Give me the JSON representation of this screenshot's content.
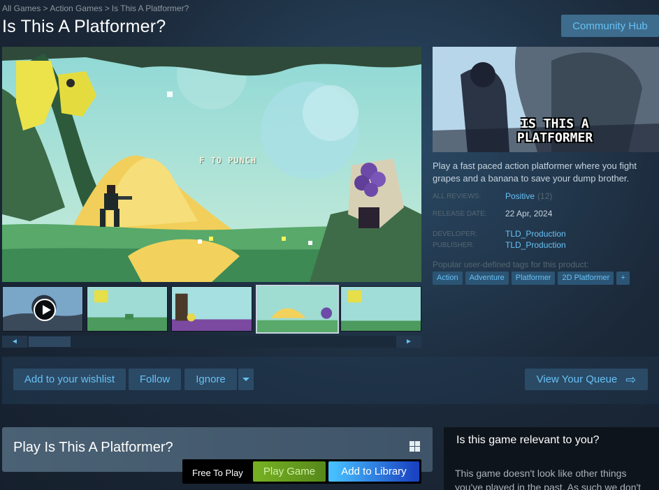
{
  "breadcrumb": {
    "items": [
      "All Games",
      "Action Games",
      "Is This A Platformer?"
    ],
    "separator": ">"
  },
  "game": {
    "title": "Is This A Platformer?",
    "screenshot_caption": "F TO PUNCH",
    "capsule_title": "IS THIS A PLATFORMER",
    "description": "Play a fast paced action platformer where you fight grapes and a banana to save your dump brother."
  },
  "header": {
    "community_hub": "Community Hub"
  },
  "meta": {
    "reviews_label": "ALL REVIEWS:",
    "reviews_value": "Positive",
    "reviews_count": "(12)",
    "release_label": "RELEASE DATE:",
    "release_value": "22 Apr, 2024",
    "developer_label": "DEVELOPER:",
    "developer_value": "TLD_Production",
    "publisher_label": "PUBLISHER:",
    "publisher_value": "TLD_Production"
  },
  "tags": {
    "label": "Popular user-defined tags for this product:",
    "items": [
      "Action",
      "Adventure",
      "Platformer",
      "2D Platformer",
      "+"
    ]
  },
  "gallery": {
    "scroll_left": "◄",
    "scroll_right": "►",
    "selected_index": 3,
    "thumb_count": 5
  },
  "actions": {
    "wishlist": "Add to your wishlist",
    "follow": "Follow",
    "ignore": "Ignore",
    "queue": "View Your Queue",
    "queue_icon": "⇨"
  },
  "purchase": {
    "play_title": "Play Is This A Platformer?",
    "price": "Free To Play",
    "play_button": "Play Game",
    "library_button": "Add to Library"
  },
  "relevance": {
    "title": "Is this game relevant to you?",
    "text": "This game doesn't look like other things you've played in the past. As such we don't"
  },
  "colors": {
    "accent_link": "#67c1f5",
    "background": "#1b2838",
    "play_green": "#75b022",
    "library_blue": "#47bfff"
  }
}
